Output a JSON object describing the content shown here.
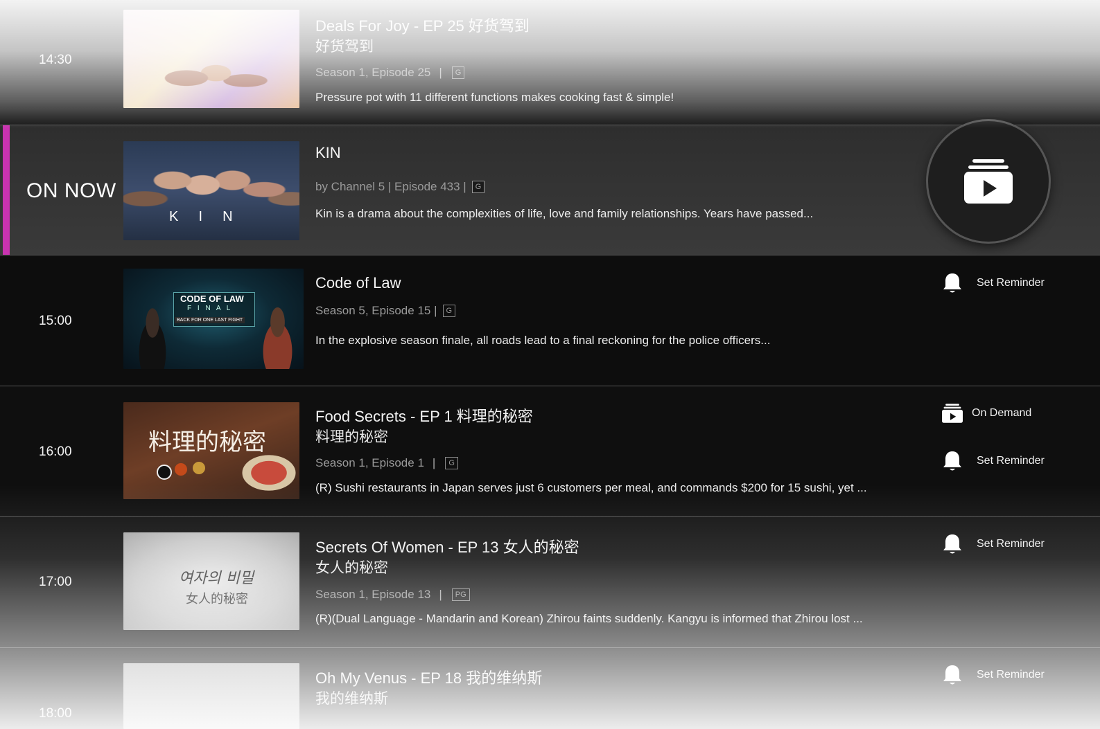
{
  "rows": [
    {
      "time": "14:30",
      "title": "Deals For Joy - EP 25 好货驾到",
      "subtitle": "好货驾到",
      "meta": "Season 1, Episode 25",
      "rating": "G",
      "description": "Pressure pot with 11 different functions makes cooking fast & simple!"
    },
    {
      "status": "ON NOW",
      "title": "KIN",
      "meta": "by Channel 5 | Episode 433 |",
      "rating": "G",
      "description": "Kin is a drama about the complexities of life, love and family relationships. Years have passed...",
      "thumb_text": "K  I  N"
    },
    {
      "time": "15:00",
      "title": "Code of Law",
      "meta": "Season 5, Episode 15 |",
      "rating": "G",
      "description": "In the explosive season finale, all roads lead to a final reckoning for the police officers...",
      "reminder_label": "Set Reminder",
      "thumb_text": "CODE OF LAW",
      "thumb_sub": "F I N A L",
      "thumb_tag": "BACK FOR ONE LAST FIGHT"
    },
    {
      "time": "16:00",
      "title": "Food Secrets - EP 1 料理的秘密",
      "subtitle": "料理的秘密",
      "meta": "Season 1, Episode 1",
      "rating": "G",
      "description": "(R) Sushi restaurants in Japan serves just 6 customers per meal, and commands $200 for 15 sushi, yet ...",
      "on_demand_label": "On Demand",
      "reminder_label": "Set Reminder",
      "thumb_text": "料理的秘密"
    },
    {
      "time": "17:00",
      "title": "Secrets Of Women - EP 13 女人的秘密",
      "subtitle": "女人的秘密",
      "meta": "Season 1, Episode 13",
      "rating": "PG",
      "description": "(R)(Dual Language - Mandarin and Korean) Zhirou faints suddenly. Kangyu is informed that Zhirou lost ...",
      "reminder_label": "Set Reminder",
      "thumb_text": "여자의 비밀",
      "thumb_sub": "女人的秘密"
    },
    {
      "time": "18:00",
      "title": "Oh My Venus - EP 18 我的维纳斯",
      "subtitle": "我的维纳斯",
      "reminder_label": "Set Reminder"
    }
  ],
  "colors": {
    "accent": "#c933b0",
    "on_now_row": "#333333",
    "row_dark": "#0d0d0d",
    "divider": "#555555"
  }
}
